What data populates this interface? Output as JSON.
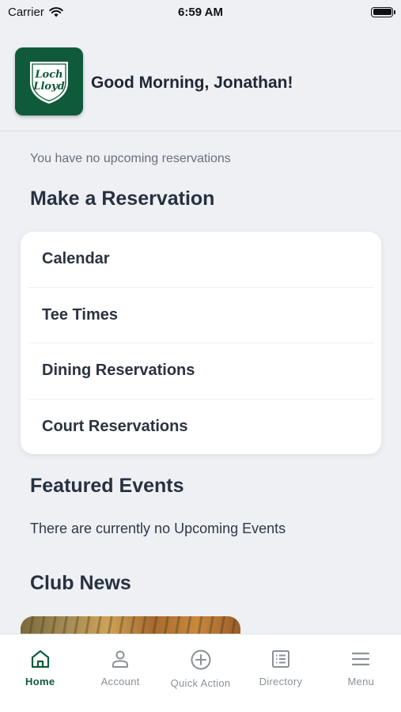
{
  "status_bar": {
    "carrier": "Carrier",
    "time": "6:59 AM"
  },
  "header": {
    "logo_text_line1": "Loch",
    "logo_text_line2": "Lloyd",
    "greeting": "Good Morning, Jonathan!"
  },
  "reservations": {
    "empty_message": "You have no upcoming reservations",
    "section_title": "Make a Reservation",
    "items": [
      {
        "label": "Calendar"
      },
      {
        "label": "Tee Times"
      },
      {
        "label": "Dining Reservations"
      },
      {
        "label": "Court Reservations"
      }
    ]
  },
  "events": {
    "section_title": "Featured Events",
    "empty_message": "There are currently no Upcoming Events"
  },
  "news": {
    "section_title": "Club News"
  },
  "tabbar": {
    "items": [
      {
        "label": "Home",
        "icon": "home-icon",
        "active": true
      },
      {
        "label": "Account",
        "icon": "account-icon",
        "active": false
      },
      {
        "label": "Quick Action",
        "icon": "plus-circle-icon",
        "active": false
      },
      {
        "label": "Directory",
        "icon": "directory-icon",
        "active": false
      },
      {
        "label": "Menu",
        "icon": "menu-icon",
        "active": false
      }
    ]
  },
  "colors": {
    "brand_green": "#0f5a3a",
    "background": "#eef0f4",
    "inactive_tab": "#8b9099"
  }
}
